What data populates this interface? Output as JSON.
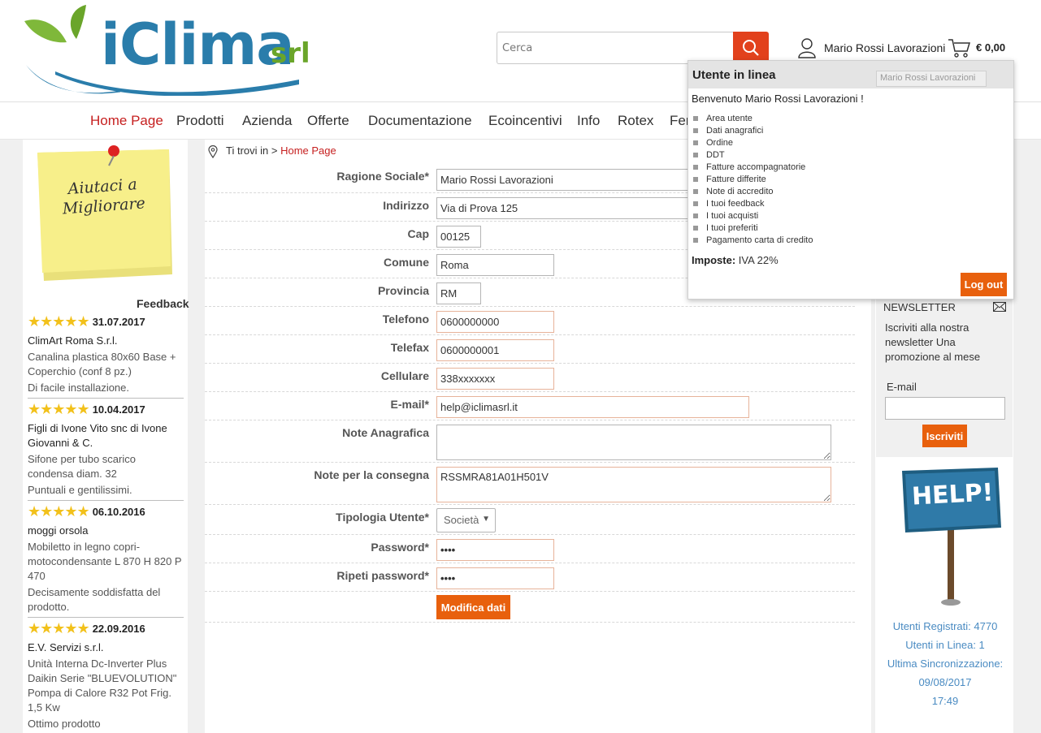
{
  "header": {
    "logo_text": "iClima",
    "logo_suffix": "srl",
    "search_placeholder": "Cerca",
    "user_name": "Mario Rossi Lavorazioni",
    "cart_total": "€ 0,00"
  },
  "nav": {
    "items": [
      "Home Page",
      "Prodotti",
      "Azienda",
      "Offerte",
      "Documentazione",
      "Ecoincentivi",
      "Info",
      "Rotex",
      "Fer"
    ]
  },
  "sidebar": {
    "postit_text": "Aiutaci a Migliorare",
    "feedback_title": "Feedback",
    "reviews": [
      {
        "stars": "★★★★★",
        "rating": 5,
        "date": "31.07.2017",
        "author": "ClimArt Roma S.r.l.",
        "product": "Canalina plastica 80x60 Base + Coperchio (conf 8 pz.)",
        "comment": "Di facile installazione."
      },
      {
        "stars": "★★★★★",
        "rating": 5,
        "date": "10.04.2017",
        "author": "Figli di Ivone Vito snc di Ivone Giovanni & C.",
        "product": "Sifone per tubo scarico condensa diam. 32",
        "comment": "Puntuali e gentilissimi."
      },
      {
        "stars": "★★★★★",
        "rating": 5,
        "date": "06.10.2016",
        "author": "moggi orsola",
        "product": "Mobiletto in legno copri-motocondensante L 870 H 820 P 470",
        "comment": "Decisamente soddisfatta del prodotto."
      },
      {
        "stars": "★★★★★",
        "rating": 5,
        "date": "22.09.2016",
        "author": "E.V. Servizi s.r.l.",
        "product": "Unità Interna Dc-Inverter Plus Daikin Serie \"BLUEVOLUTION\" Pompa di Calore R32 Pot Frig. 1,5 Kw",
        "comment": "Ottimo prodotto"
      }
    ]
  },
  "breadcrumb": {
    "prefix": "Ti trovi in >",
    "current": "Home Page"
  },
  "form": {
    "ragione_sociale": {
      "label": "Ragione Sociale*",
      "value": "Mario Rossi Lavorazioni"
    },
    "indirizzo": {
      "label": "Indirizzo",
      "value": "Via di Prova 125"
    },
    "cap": {
      "label": "Cap",
      "value": "00125"
    },
    "comune": {
      "label": "Comune",
      "value": "Roma"
    },
    "provincia": {
      "label": "Provincia",
      "value": "RM"
    },
    "telefono": {
      "label": "Telefono",
      "value": "0600000000"
    },
    "telefax": {
      "label": "Telefax",
      "value": "0600000001"
    },
    "cellulare": {
      "label": "Cellulare",
      "value": "338xxxxxxx"
    },
    "email": {
      "label": "E-mail*",
      "value": "help@iclimasrl.it"
    },
    "note_anagrafica": {
      "label": "Note Anagrafica",
      "value": ""
    },
    "note_consegna": {
      "label": "Note per la consegna",
      "value": "RSSMRA81A01H501V"
    },
    "tipologia": {
      "label": "Tipologia Utente*",
      "value": "Società"
    },
    "password": {
      "label": "Password*",
      "value": "••••"
    },
    "ripeti_password": {
      "label": "Ripeti password*",
      "value": "••••"
    },
    "submit_label": "Modifica dati"
  },
  "popup": {
    "title": "Utente in linea",
    "tag": "Mario Rossi Lavorazioni",
    "welcome": "Benvenuto Mario Rossi Lavorazioni !",
    "menu": [
      "Area utente",
      "Dati anagrafici",
      "Ordine",
      "DDT",
      "Fatture accompagnatorie",
      "Fatture differite",
      "Note di accredito",
      "I tuoi feedback",
      "I tuoi acquisti",
      "I tuoi preferiti",
      "Pagamento carta di credito"
    ],
    "tax_label": "Imposte:",
    "tax_value": "IVA 22%",
    "logout_label": "Log out"
  },
  "newsletter": {
    "title": "NEWSLETTER",
    "desc": "Iscriviti alla nostra newsletter Una promozione al mese",
    "email_label": "E-mail",
    "subscribe_label": "Iscriviti"
  },
  "help_sign": "HELP!",
  "stats": {
    "registrati": "Utenti Registrati: 4770",
    "in_linea": "Utenti in Linea: 1",
    "sync_label": "Ultima Sincronizzazione:",
    "sync_date": "09/08/2017",
    "sync_time": "17:49"
  },
  "colors": {
    "accent": "#e8600d",
    "search_button": "#e2411c",
    "nav_active": "#c62020",
    "stats_text": "#4a8bc2",
    "stars": "#f2c11b"
  }
}
